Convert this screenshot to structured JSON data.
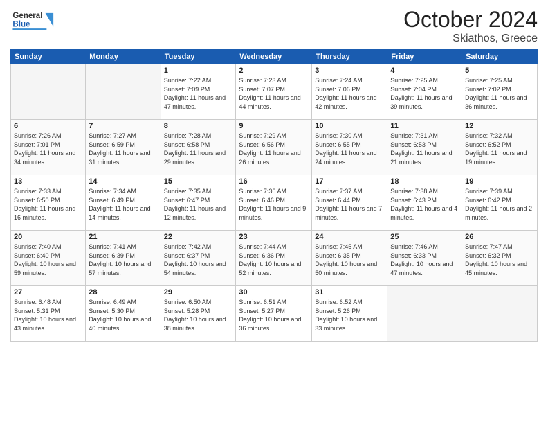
{
  "header": {
    "logo_general": "General",
    "logo_blue": "Blue",
    "title": "October 2024",
    "subtitle": "Skiathos, Greece"
  },
  "weekdays": [
    "Sunday",
    "Monday",
    "Tuesday",
    "Wednesday",
    "Thursday",
    "Friday",
    "Saturday"
  ],
  "weeks": [
    [
      {
        "day": "",
        "sunrise": "",
        "sunset": "",
        "daylight": ""
      },
      {
        "day": "",
        "sunrise": "",
        "sunset": "",
        "daylight": ""
      },
      {
        "day": "1",
        "sunrise": "Sunrise: 7:22 AM",
        "sunset": "Sunset: 7:09 PM",
        "daylight": "Daylight: 11 hours and 47 minutes."
      },
      {
        "day": "2",
        "sunrise": "Sunrise: 7:23 AM",
        "sunset": "Sunset: 7:07 PM",
        "daylight": "Daylight: 11 hours and 44 minutes."
      },
      {
        "day": "3",
        "sunrise": "Sunrise: 7:24 AM",
        "sunset": "Sunset: 7:06 PM",
        "daylight": "Daylight: 11 hours and 42 minutes."
      },
      {
        "day": "4",
        "sunrise": "Sunrise: 7:25 AM",
        "sunset": "Sunset: 7:04 PM",
        "daylight": "Daylight: 11 hours and 39 minutes."
      },
      {
        "day": "5",
        "sunrise": "Sunrise: 7:25 AM",
        "sunset": "Sunset: 7:02 PM",
        "daylight": "Daylight: 11 hours and 36 minutes."
      }
    ],
    [
      {
        "day": "6",
        "sunrise": "Sunrise: 7:26 AM",
        "sunset": "Sunset: 7:01 PM",
        "daylight": "Daylight: 11 hours and 34 minutes."
      },
      {
        "day": "7",
        "sunrise": "Sunrise: 7:27 AM",
        "sunset": "Sunset: 6:59 PM",
        "daylight": "Daylight: 11 hours and 31 minutes."
      },
      {
        "day": "8",
        "sunrise": "Sunrise: 7:28 AM",
        "sunset": "Sunset: 6:58 PM",
        "daylight": "Daylight: 11 hours and 29 minutes."
      },
      {
        "day": "9",
        "sunrise": "Sunrise: 7:29 AM",
        "sunset": "Sunset: 6:56 PM",
        "daylight": "Daylight: 11 hours and 26 minutes."
      },
      {
        "day": "10",
        "sunrise": "Sunrise: 7:30 AM",
        "sunset": "Sunset: 6:55 PM",
        "daylight": "Daylight: 11 hours and 24 minutes."
      },
      {
        "day": "11",
        "sunrise": "Sunrise: 7:31 AM",
        "sunset": "Sunset: 6:53 PM",
        "daylight": "Daylight: 11 hours and 21 minutes."
      },
      {
        "day": "12",
        "sunrise": "Sunrise: 7:32 AM",
        "sunset": "Sunset: 6:52 PM",
        "daylight": "Daylight: 11 hours and 19 minutes."
      }
    ],
    [
      {
        "day": "13",
        "sunrise": "Sunrise: 7:33 AM",
        "sunset": "Sunset: 6:50 PM",
        "daylight": "Daylight: 11 hours and 16 minutes."
      },
      {
        "day": "14",
        "sunrise": "Sunrise: 7:34 AM",
        "sunset": "Sunset: 6:49 PM",
        "daylight": "Daylight: 11 hours and 14 minutes."
      },
      {
        "day": "15",
        "sunrise": "Sunrise: 7:35 AM",
        "sunset": "Sunset: 6:47 PM",
        "daylight": "Daylight: 11 hours and 12 minutes."
      },
      {
        "day": "16",
        "sunrise": "Sunrise: 7:36 AM",
        "sunset": "Sunset: 6:46 PM",
        "daylight": "Daylight: 11 hours and 9 minutes."
      },
      {
        "day": "17",
        "sunrise": "Sunrise: 7:37 AM",
        "sunset": "Sunset: 6:44 PM",
        "daylight": "Daylight: 11 hours and 7 minutes."
      },
      {
        "day": "18",
        "sunrise": "Sunrise: 7:38 AM",
        "sunset": "Sunset: 6:43 PM",
        "daylight": "Daylight: 11 hours and 4 minutes."
      },
      {
        "day": "19",
        "sunrise": "Sunrise: 7:39 AM",
        "sunset": "Sunset: 6:42 PM",
        "daylight": "Daylight: 11 hours and 2 minutes."
      }
    ],
    [
      {
        "day": "20",
        "sunrise": "Sunrise: 7:40 AM",
        "sunset": "Sunset: 6:40 PM",
        "daylight": "Daylight: 10 hours and 59 minutes."
      },
      {
        "day": "21",
        "sunrise": "Sunrise: 7:41 AM",
        "sunset": "Sunset: 6:39 PM",
        "daylight": "Daylight: 10 hours and 57 minutes."
      },
      {
        "day": "22",
        "sunrise": "Sunrise: 7:42 AM",
        "sunset": "Sunset: 6:37 PM",
        "daylight": "Daylight: 10 hours and 54 minutes."
      },
      {
        "day": "23",
        "sunrise": "Sunrise: 7:44 AM",
        "sunset": "Sunset: 6:36 PM",
        "daylight": "Daylight: 10 hours and 52 minutes."
      },
      {
        "day": "24",
        "sunrise": "Sunrise: 7:45 AM",
        "sunset": "Sunset: 6:35 PM",
        "daylight": "Daylight: 10 hours and 50 minutes."
      },
      {
        "day": "25",
        "sunrise": "Sunrise: 7:46 AM",
        "sunset": "Sunset: 6:33 PM",
        "daylight": "Daylight: 10 hours and 47 minutes."
      },
      {
        "day": "26",
        "sunrise": "Sunrise: 7:47 AM",
        "sunset": "Sunset: 6:32 PM",
        "daylight": "Daylight: 10 hours and 45 minutes."
      }
    ],
    [
      {
        "day": "27",
        "sunrise": "Sunrise: 6:48 AM",
        "sunset": "Sunset: 5:31 PM",
        "daylight": "Daylight: 10 hours and 43 minutes."
      },
      {
        "day": "28",
        "sunrise": "Sunrise: 6:49 AM",
        "sunset": "Sunset: 5:30 PM",
        "daylight": "Daylight: 10 hours and 40 minutes."
      },
      {
        "day": "29",
        "sunrise": "Sunrise: 6:50 AM",
        "sunset": "Sunset: 5:28 PM",
        "daylight": "Daylight: 10 hours and 38 minutes."
      },
      {
        "day": "30",
        "sunrise": "Sunrise: 6:51 AM",
        "sunset": "Sunset: 5:27 PM",
        "daylight": "Daylight: 10 hours and 36 minutes."
      },
      {
        "day": "31",
        "sunrise": "Sunrise: 6:52 AM",
        "sunset": "Sunset: 5:26 PM",
        "daylight": "Daylight: 10 hours and 33 minutes."
      },
      {
        "day": "",
        "sunrise": "",
        "sunset": "",
        "daylight": ""
      },
      {
        "day": "",
        "sunrise": "",
        "sunset": "",
        "daylight": ""
      }
    ]
  ]
}
